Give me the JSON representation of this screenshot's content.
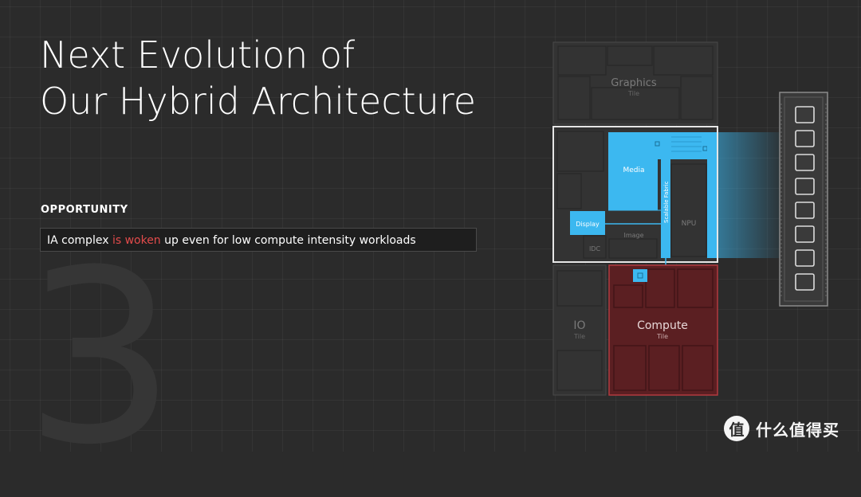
{
  "slide": {
    "number": "3",
    "title_lines": [
      "Next Evolution of",
      "Our Hybrid Architecture"
    ],
    "opportunity_label": "OPPORTUNITY",
    "opportunity_text": {
      "pre": "IA complex ",
      "highlight": "is woken",
      "post": " up even for low compute intensity workloads"
    }
  },
  "diagram": {
    "graphics_tile": {
      "name": "Graphics",
      "sub": "Tile"
    },
    "soc_blocks": {
      "media": "Media",
      "display": "Display",
      "image": "Image",
      "idc": "IDC",
      "npu": "NPU",
      "fabric": "Scalable Fabric"
    },
    "io_tile": {
      "name": "IO",
      "sub": "Tile"
    },
    "compute_tile": {
      "name": "Compute",
      "sub": "Tile"
    }
  },
  "watermark": {
    "text": "什么值得买",
    "glyph": "值"
  },
  "colors": {
    "background": "#2b2b2b",
    "accent_blue": "#3cb8f0",
    "compute_red": "#5b1f22",
    "highlight_red": "#e24b4b"
  }
}
